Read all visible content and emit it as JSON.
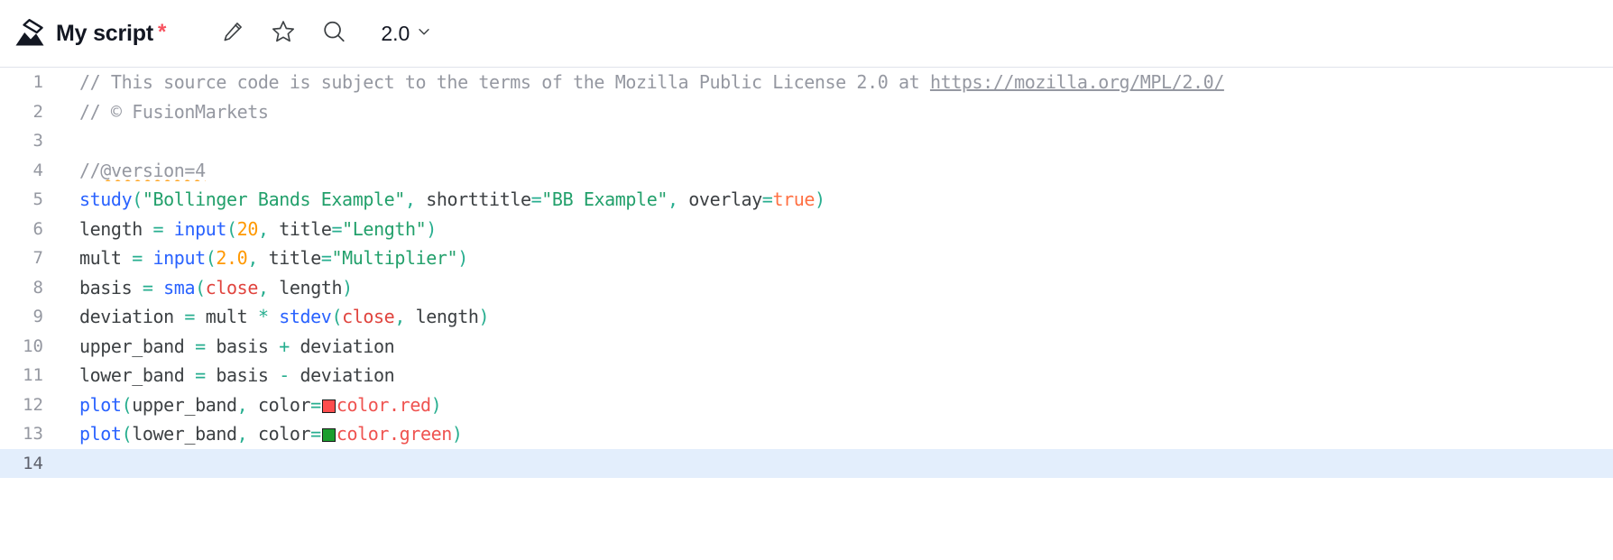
{
  "header": {
    "logo_icon": "tradingview-mountain-logo",
    "script_title": "My script",
    "unsaved_marker": "*",
    "edit_icon": "pencil-icon",
    "favorite_icon": "star-icon",
    "search_icon": "magnifier-icon",
    "version_label": "2.0",
    "version_chevron_icon": "chevron-down-icon"
  },
  "editor": {
    "active_line": 14,
    "colors": {
      "comment": "#9598a1",
      "function": "#2962ff",
      "string": "#22a06b",
      "number": "#ff9800",
      "builtin": "#e0443e",
      "operator": "#27ae8f",
      "color_value": "#ef5350",
      "active_line_bg": "#e3eefc",
      "swatch_red": "#ff4d4d",
      "swatch_green": "#1a9e2e"
    },
    "lines": [
      {
        "n": "1",
        "text": "// This source code is subject to the terms of the Mozilla Public License 2.0 at https://mozilla.org/MPL/2.0/"
      },
      {
        "n": "2",
        "text": "// © FusionMarkets"
      },
      {
        "n": "3",
        "text": ""
      },
      {
        "n": "4",
        "text": "//@version=4"
      },
      {
        "n": "5",
        "text": "study(\"Bollinger Bands Example\", shorttitle=\"BB Example\", overlay=true)"
      },
      {
        "n": "6",
        "text": "length = input(20, title=\"Length\")"
      },
      {
        "n": "7",
        "text": "mult = input(2.0, title=\"Multiplier\")"
      },
      {
        "n": "8",
        "text": "basis = sma(close, length)"
      },
      {
        "n": "9",
        "text": "deviation = mult * stdev(close, length)"
      },
      {
        "n": "10",
        "text": "upper_band = basis + deviation"
      },
      {
        "n": "11",
        "text": "lower_band = basis - deviation"
      },
      {
        "n": "12",
        "text": "plot(upper_band, color=color.red)"
      },
      {
        "n": "13",
        "text": "plot(lower_band, color=color.green)"
      },
      {
        "n": "14",
        "text": ""
      }
    ],
    "tokens": {
      "l1_comment_a": "// This source code is subject to the terms of the Mozilla Public License 2.0 at ",
      "l1_url": "https://mozilla.org/MPL/2.0/",
      "l2": "// © FusionMarkets",
      "l4_a": "//",
      "l4_b": "@version=4",
      "l5_fn": "study",
      "l5_p1": "(",
      "l5_s1": "\"Bollinger Bands Example\"",
      "l5_c1": ", ",
      "l5_t1": "shorttitle",
      "l5_eq1": "=",
      "l5_s2": "\"BB Example\"",
      "l5_c2": ", ",
      "l5_t2": "overlay",
      "l5_eq2": "=",
      "l5_bool": "true",
      "l5_p2": ")",
      "l6_var": "length ",
      "l6_eq": "=",
      "l6_fn": " input",
      "l6_p1": "(",
      "l6_num": "20",
      "l6_c": ", ",
      "l6_t": "title",
      "l6_eq2": "=",
      "l6_s": "\"Length\"",
      "l6_p2": ")",
      "l7_var": "mult ",
      "l7_eq": "=",
      "l7_fn": " input",
      "l7_p1": "(",
      "l7_num": "2.0",
      "l7_c": ", ",
      "l7_t": "title",
      "l7_eq2": "=",
      "l7_s": "\"Multiplier\"",
      "l7_p2": ")",
      "l8_var": "basis ",
      "l8_eq": "=",
      "l8_fn": " sma",
      "l8_p1": "(",
      "l8_builtin": "close",
      "l8_c": ",",
      "l8_arg": " length",
      "l8_p2": ")",
      "l9_var": "deviation ",
      "l9_eq": "=",
      "l9_a": " mult ",
      "l9_mul": "*",
      "l9_fn": " stdev",
      "l9_p1": "(",
      "l9_builtin": "close",
      "l9_c": ",",
      "l9_arg": " length",
      "l9_p2": ")",
      "l10_var": "upper_band ",
      "l10_eq": "=",
      "l10_a": " basis ",
      "l10_op": "+",
      "l10_b": " deviation",
      "l11_var": "lower_band ",
      "l11_eq": "=",
      "l11_a": " basis ",
      "l11_op": "-",
      "l11_b": " deviation",
      "l12_fn": "plot",
      "l12_p1": "(",
      "l12_arg": "upper_band",
      "l12_c": ",",
      "l12_t": " color",
      "l12_eq": "=",
      "l12_val": "color.red",
      "l12_p2": ")",
      "l13_fn": "plot",
      "l13_p1": "(",
      "l13_arg": "lower_band",
      "l13_c": ",",
      "l13_t": " color",
      "l13_eq": "=",
      "l13_val": "color.green",
      "l13_p2": ")"
    }
  }
}
